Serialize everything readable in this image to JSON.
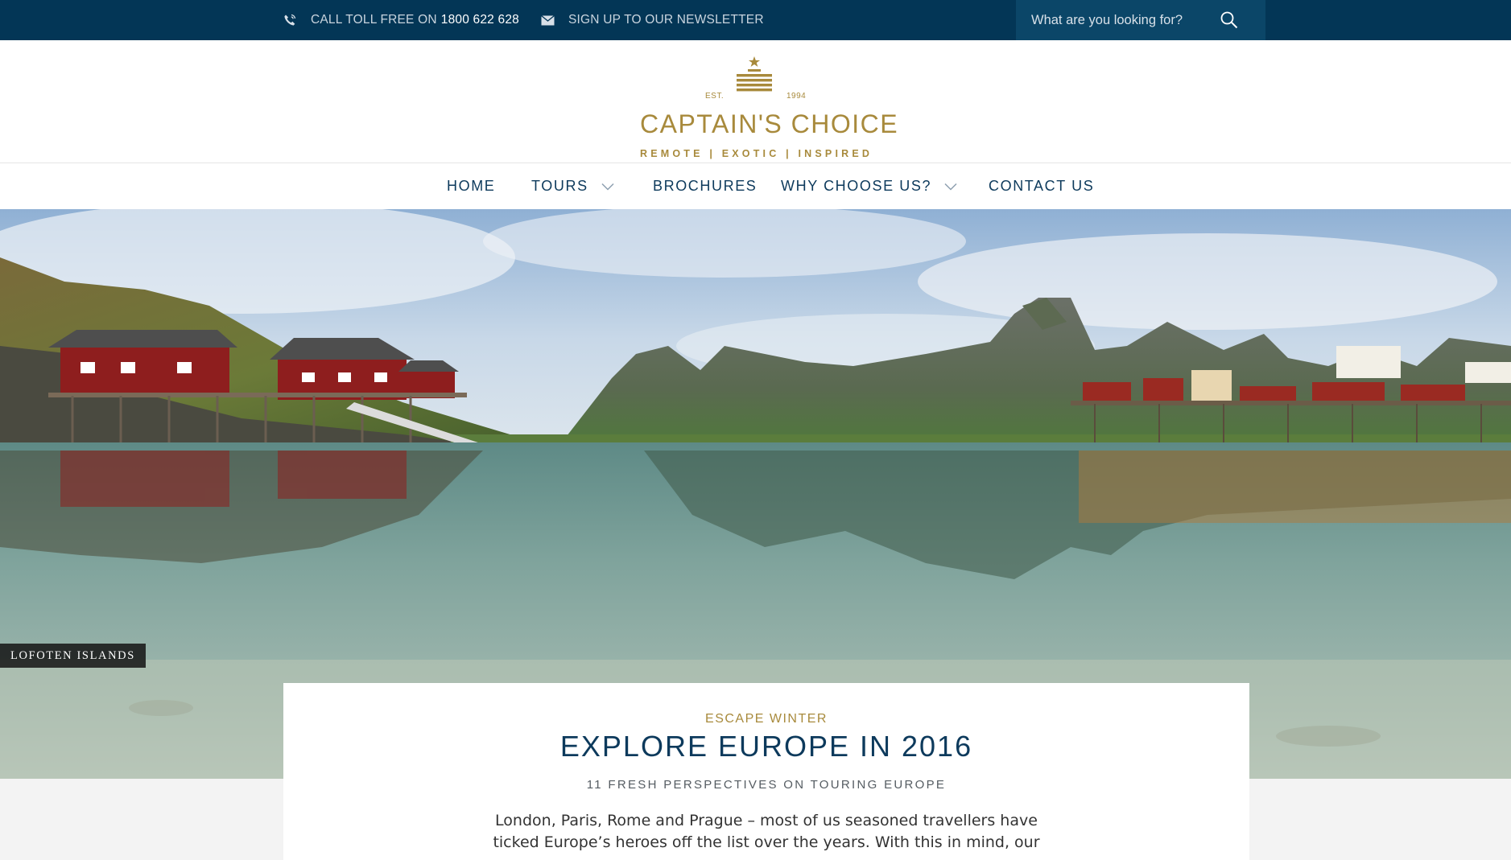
{
  "topbar": {
    "phone_icon": "phone-icon",
    "phone_label": "CALL TOLL FREE ON",
    "phone_number": "1800 622 628",
    "newsletter_icon": "envelope-icon",
    "newsletter_label": "SIGN UP TO OUR NEWSLETTER",
    "search_placeholder": "What are you looking for?",
    "search_icon": "search-icon"
  },
  "logo": {
    "est": "EST.",
    "year": "1994",
    "name": "CAPTAIN'S CHOICE",
    "tagline": "REMOTE | EXOTIC | INSPIRED"
  },
  "nav": {
    "items": [
      {
        "label": "HOME"
      },
      {
        "label": "TOURS"
      },
      {
        "label": "BROCHURES"
      },
      {
        "label": "WHY CHOOSE US?"
      },
      {
        "label": "CONTACT US"
      }
    ]
  },
  "hero": {
    "caption": "LOFOTEN ISLANDS"
  },
  "feature": {
    "kicker": "ESCAPE WINTER",
    "title": "EXPLORE EUROPE IN 2016",
    "subtitle": "11 FRESH PERSPECTIVES ON TOURING EUROPE",
    "body": "London, Paris, Rome and Prague – most of us seasoned travellers have ticked Europe’s heroes off the list over the years. With this in mind, our"
  },
  "colors": {
    "topbar_bg": "#033656",
    "navy": "#0d3a5c",
    "gold": "#a88a3c"
  }
}
